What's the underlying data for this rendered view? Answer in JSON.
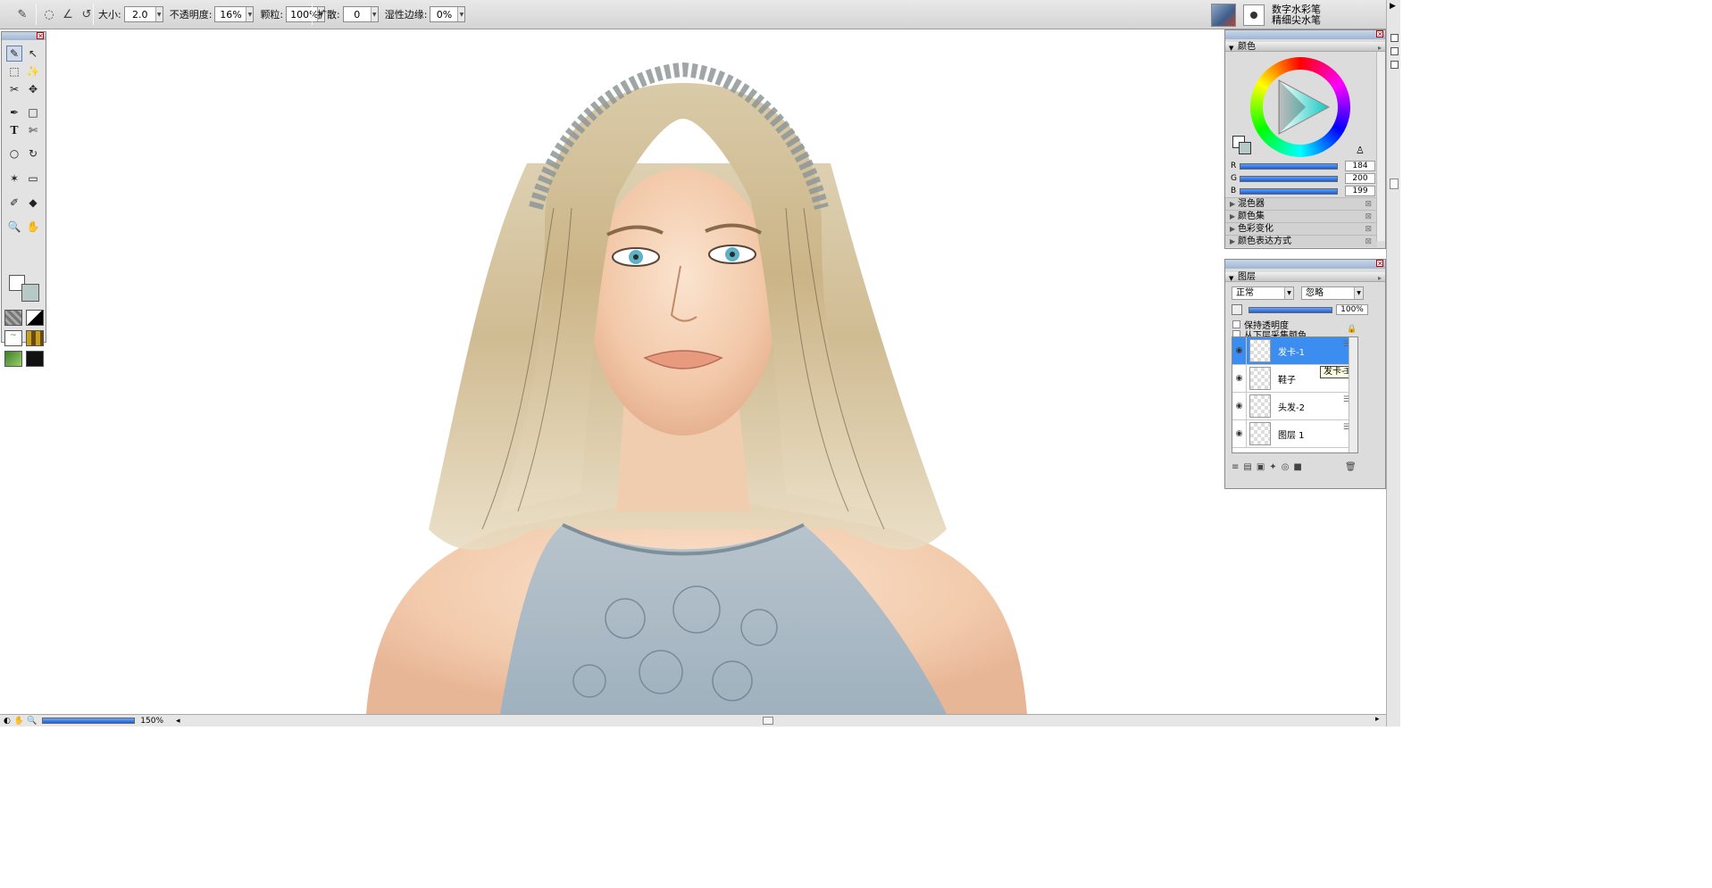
{
  "toolbar": {
    "size_label": "大小:",
    "size_value": "2.0",
    "opacity_label": "不透明度:",
    "opacity_value": "16%",
    "grain_label": "颗粒:",
    "grain_value": "100%",
    "diffusion_label": "扩散:",
    "diffusion_value": "0",
    "wet_fringe_label": "湿性边缘:",
    "wet_fringe_value": "0%"
  },
  "brush": {
    "category": "数字水彩笔",
    "variant": "精细尖水笔"
  },
  "color_panel": {
    "title": "颜色",
    "r_label": "R",
    "g_label": "G",
    "b_label": "B",
    "r_value": "184",
    "g_value": "200",
    "b_value": "199",
    "current_color": "#b8c8c7",
    "collapsed": [
      "混色器",
      "颜色集",
      "色彩变化",
      "颜色表达方式"
    ]
  },
  "layers_panel": {
    "title": "图层",
    "blend_mode": "正常",
    "composite": "忽略",
    "opacity_value": "100%",
    "preserve_transparency": "保持透明度",
    "pick_up_underlying": "从下层采集颜色",
    "layers": [
      {
        "name": "发卡-1",
        "selected": true
      },
      {
        "name": "鞋子",
        "selected": false
      },
      {
        "name": "头发-2",
        "selected": false
      },
      {
        "name": "图层 1",
        "selected": false
      }
    ],
    "tooltip": "发卡-1"
  },
  "status": {
    "zoom": "150%"
  },
  "icons": {
    "selected_tool": "brush-icon",
    "toolbar_brush": "brush-icon"
  }
}
